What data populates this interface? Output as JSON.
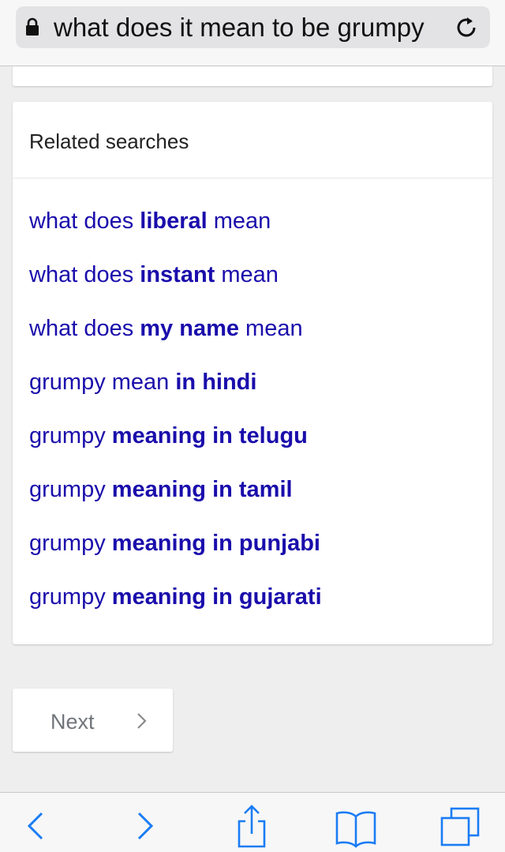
{
  "browser": {
    "url_text": "what does it mean to be grumpy",
    "icons": {
      "lock": "lock-icon",
      "reload": "reload-icon"
    }
  },
  "related": {
    "header": "Related searches",
    "items": [
      {
        "parts": [
          {
            "t": "what does ",
            "b": false
          },
          {
            "t": "liberal",
            "b": true
          },
          {
            "t": " mean",
            "b": false
          }
        ]
      },
      {
        "parts": [
          {
            "t": "what does ",
            "b": false
          },
          {
            "t": "instant",
            "b": true
          },
          {
            "t": " mean",
            "b": false
          }
        ]
      },
      {
        "parts": [
          {
            "t": "what does ",
            "b": false
          },
          {
            "t": "my name",
            "b": true
          },
          {
            "t": " mean",
            "b": false
          }
        ]
      },
      {
        "parts": [
          {
            "t": "grumpy mean ",
            "b": false
          },
          {
            "t": "in hindi",
            "b": true
          }
        ]
      },
      {
        "parts": [
          {
            "t": "grumpy ",
            "b": false
          },
          {
            "t": "meaning in telugu",
            "b": true
          }
        ]
      },
      {
        "parts": [
          {
            "t": "grumpy ",
            "b": false
          },
          {
            "t": "meaning in tamil",
            "b": true
          }
        ]
      },
      {
        "parts": [
          {
            "t": "grumpy ",
            "b": false
          },
          {
            "t": "meaning in punjabi",
            "b": true
          }
        ]
      },
      {
        "parts": [
          {
            "t": "grumpy ",
            "b": false
          },
          {
            "t": "meaning in gujarati",
            "b": true
          }
        ]
      }
    ],
    "link_color": "#1a0dab"
  },
  "pagination": {
    "next_label": "Next",
    "chevron": "chevron-right-icon"
  },
  "toolbar": {
    "icons": [
      "back-icon",
      "forward-icon",
      "share-icon",
      "bookmarks-icon",
      "tabs-icon"
    ],
    "accent": "#1a7cf5"
  }
}
